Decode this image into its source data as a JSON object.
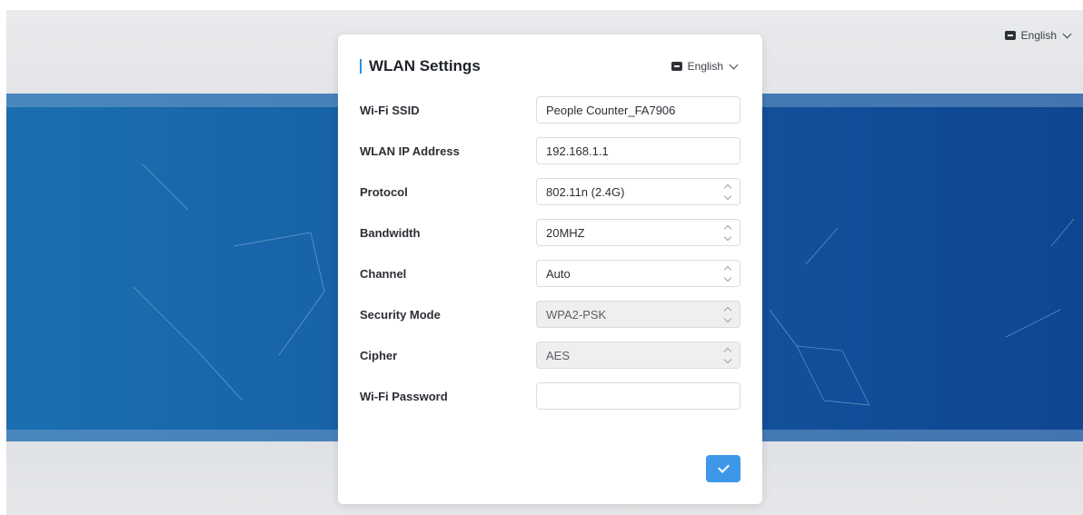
{
  "top_bar": {
    "language": "English"
  },
  "dialog": {
    "title": "WLAN Settings",
    "language": "English",
    "fields": [
      {
        "label": "Wi-Fi SSID",
        "value": "People Counter_FA7906",
        "type": "text"
      },
      {
        "label": "WLAN IP Address",
        "value": "192.168.1.1",
        "type": "text"
      },
      {
        "label": "Protocol",
        "value": "802.11n (2.4G)",
        "type": "select"
      },
      {
        "label": "Bandwidth",
        "value": "20MHZ",
        "type": "select"
      },
      {
        "label": "Channel",
        "value": "Auto",
        "type": "select"
      },
      {
        "label": "Security Mode",
        "value": "WPA2-PSK",
        "type": "select-disabled"
      },
      {
        "label": "Cipher",
        "value": "AES",
        "type": "select-disabled"
      },
      {
        "label": "Wi-Fi Password",
        "value": "",
        "type": "password"
      }
    ],
    "submit_icon": "check-icon"
  },
  "colors": {
    "accent": "#3f97ea",
    "band": "#1761a6"
  }
}
